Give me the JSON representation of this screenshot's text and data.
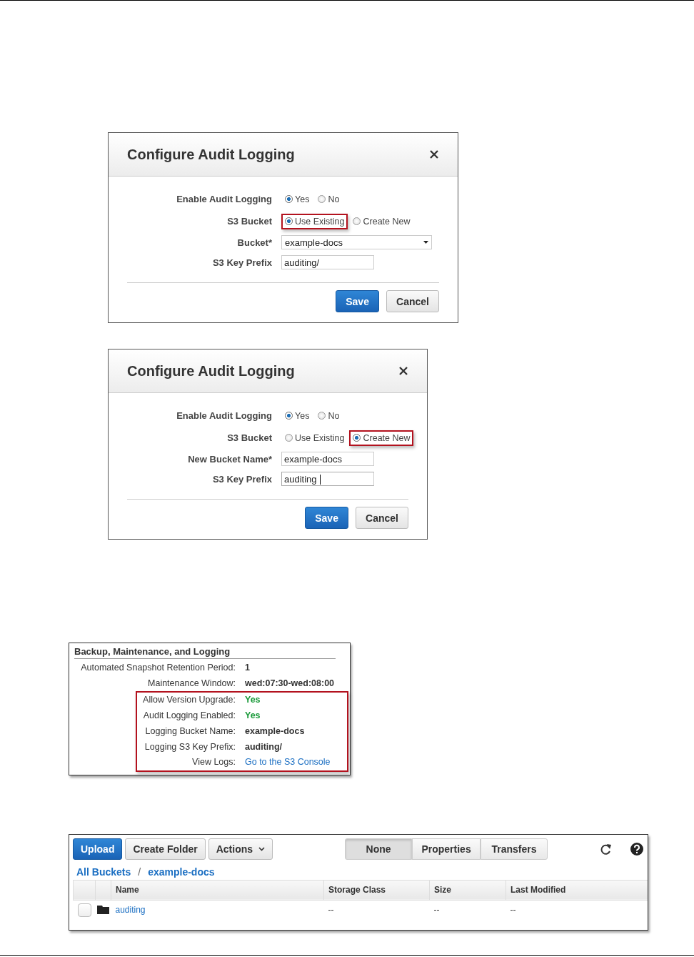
{
  "dialogs": [
    {
      "title": "Configure Audit Logging",
      "fields": [
        {
          "kind": "radio",
          "label": "Enable Audit Logging",
          "options": [
            {
              "label": "Yes",
              "selected": true,
              "highlighted": false
            },
            {
              "label": "No",
              "selected": false,
              "highlighted": false
            }
          ]
        },
        {
          "kind": "radio",
          "label": "S3 Bucket",
          "options": [
            {
              "label": "Use Existing",
              "selected": true,
              "highlighted": true
            },
            {
              "label": "Create New",
              "selected": false,
              "highlighted": false
            }
          ]
        },
        {
          "kind": "select",
          "label": "Bucket*",
          "value": "example-docs"
        },
        {
          "kind": "text",
          "label": "S3 Key Prefix",
          "value": "auditing/",
          "focused": false
        }
      ],
      "buttons": [
        {
          "label": "Save",
          "kind": "primary"
        },
        {
          "label": "Cancel",
          "kind": "default"
        }
      ]
    },
    {
      "title": "Configure Audit Logging",
      "fields": [
        {
          "kind": "radio",
          "label": "Enable Audit Logging",
          "options": [
            {
              "label": "Yes",
              "selected": true,
              "highlighted": false
            },
            {
              "label": "No",
              "selected": false,
              "highlighted": false
            }
          ]
        },
        {
          "kind": "radio",
          "label": "S3 Bucket",
          "options": [
            {
              "label": "Use Existing",
              "selected": false,
              "highlighted": false
            },
            {
              "label": "Create New",
              "selected": true,
              "highlighted": true
            }
          ]
        },
        {
          "kind": "text",
          "label": "New Bucket Name*",
          "value": "example-docs",
          "focused": false
        },
        {
          "kind": "text",
          "label": "S3 Key Prefix",
          "value": "auditing",
          "focused": true
        }
      ],
      "buttons": [
        {
          "label": "Save",
          "kind": "primary"
        },
        {
          "label": "Cancel",
          "kind": "default"
        }
      ]
    }
  ],
  "details": {
    "title": "Backup, Maintenance, and Logging",
    "rows": [
      {
        "label": "Automated Snapshot Retention Period:",
        "value": "1",
        "kind": "plain",
        "highlighted": false
      },
      {
        "label": "Maintenance Window:",
        "value": "wed:07:30-wed:08:00",
        "kind": "plain",
        "highlighted": false
      },
      {
        "label": "Allow Version Upgrade:",
        "value": "Yes",
        "kind": "status",
        "highlighted": true
      },
      {
        "label": "Audit Logging Enabled:",
        "value": "Yes",
        "kind": "status",
        "highlighted": true
      },
      {
        "label": "Logging Bucket Name:",
        "value": "example-docs",
        "kind": "plain",
        "highlighted": true
      },
      {
        "label": "Logging S3 Key Prefix:",
        "value": "auditing/",
        "kind": "plain",
        "highlighted": true
      },
      {
        "label": "View Logs:",
        "value": "Go to the S3 Console",
        "kind": "link",
        "highlighted": true
      }
    ]
  },
  "browser": {
    "buttons": [
      {
        "label": "Upload",
        "kind": "primary"
      },
      {
        "label": "Create Folder",
        "kind": "default"
      },
      {
        "label": "Actions",
        "kind": "menu"
      }
    ],
    "views": [
      {
        "label": "None",
        "selected": true
      },
      {
        "label": "Properties",
        "selected": false
      },
      {
        "label": "Transfers",
        "selected": false
      }
    ],
    "breadcrumb": [
      {
        "label": "All Buckets"
      },
      {
        "label": "/",
        "kind": "separator"
      },
      {
        "label": "example-docs"
      }
    ],
    "columns": [
      "Name",
      "Storage Class",
      "Size",
      "Last Modified"
    ],
    "rows": [
      {
        "name": "auditing",
        "storage_class": "--",
        "size": "--",
        "last_modified": "--",
        "checked": false
      }
    ]
  }
}
